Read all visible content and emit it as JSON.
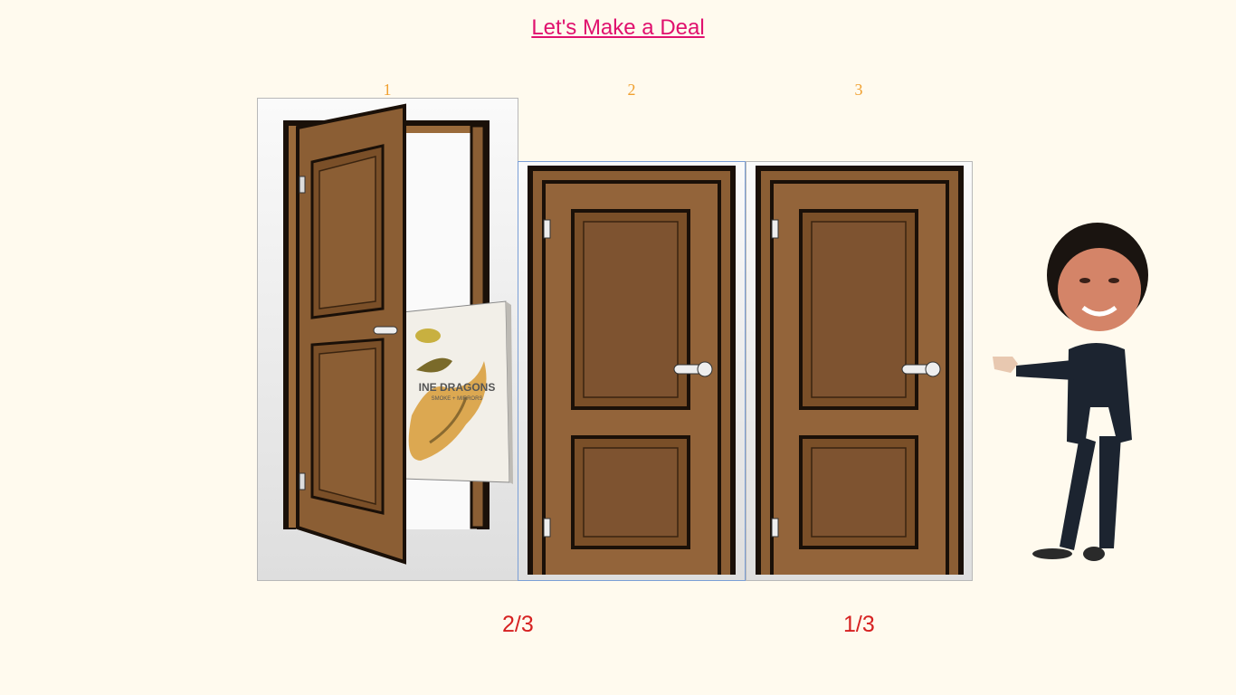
{
  "title": "Let's Make a Deal",
  "doors": [
    {
      "number": "1",
      "state": "open",
      "prize": "album-cover"
    },
    {
      "number": "2",
      "state": "closed",
      "selected": true
    },
    {
      "number": "3",
      "state": "closed",
      "selected": false
    }
  ],
  "album": {
    "band": "INE DRAGONS",
    "subtitle": "SMOKE + MIRRORS"
  },
  "probabilities": {
    "door2": "2/3",
    "door3": "1/3"
  },
  "colors": {
    "background": "#fffaee",
    "title": "#e0116e",
    "door_number": "#f0a030",
    "probability": "#d62020",
    "door_wood": "#8b5e34"
  }
}
